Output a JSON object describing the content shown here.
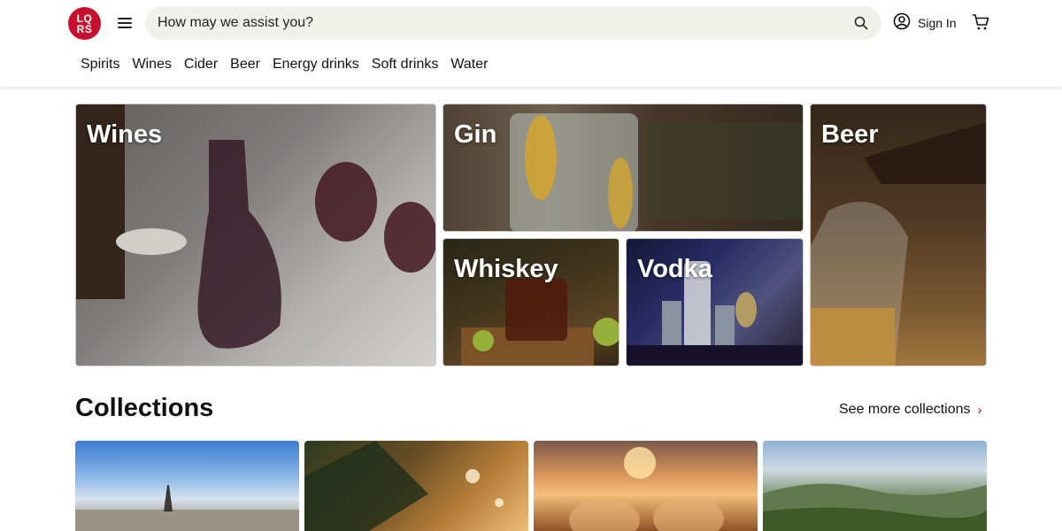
{
  "brand": {
    "logo_line1": "LQ",
    "logo_line2": "RS",
    "accent": "#c8102e"
  },
  "search": {
    "placeholder": "How may we assist you?"
  },
  "header": {
    "sign_in": "Sign In"
  },
  "nav": [
    "Spirits",
    "Wines",
    "Cider",
    "Beer",
    "Energy drinks",
    "Soft drinks",
    "Water"
  ],
  "categories": {
    "wines": "Wines",
    "gin": "Gin",
    "beer": "Beer",
    "whiskey": "Whiskey",
    "vodka": "Vodka"
  },
  "collections": {
    "title": "Collections",
    "see_more": "See more collections"
  },
  "icons": [
    "menu-icon",
    "search-icon",
    "user-icon",
    "cart-icon",
    "chevron-right-icon"
  ]
}
